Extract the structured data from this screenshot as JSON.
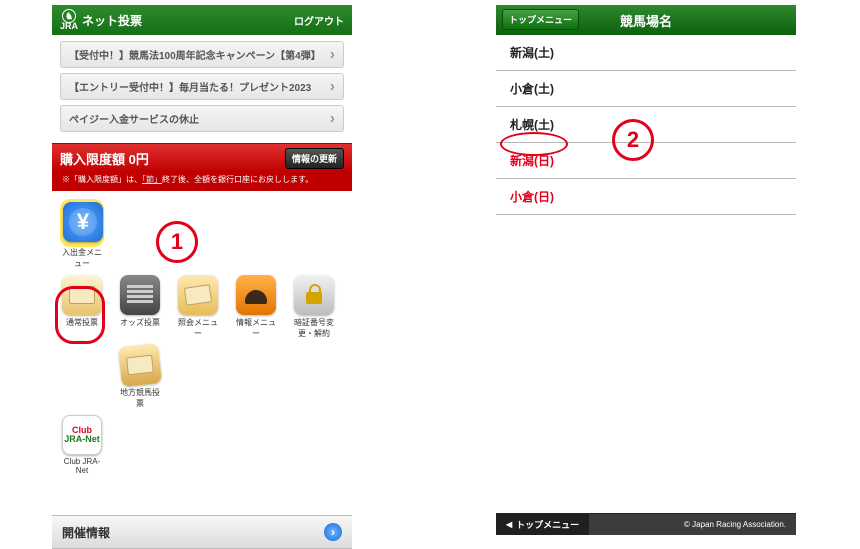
{
  "left": {
    "brand_small": "JRA",
    "title": "ネット投票",
    "logout": "ログアウト",
    "news": [
      "【受付中！】競馬法100周年記念キャンペーン【第4弾】",
      "【エントリー受付中！】毎月当たる！プレゼント2023",
      "ペイジー入金サービスの休止"
    ],
    "limit_label": "購入限度額 0円",
    "limit_button": "情報の更新",
    "limit_note_a": "※「購入限度額」は、",
    "limit_note_link": "「節」",
    "limit_note_b": "終了後、全額を銀行口座にお戻しします。",
    "icons": {
      "yen": "入出金メニュー",
      "normal": "通常投票",
      "odds": "オッズ投票",
      "refund": "照会メニュー",
      "info": "情報メニュー",
      "lock": "暗証番号変更・解約",
      "chikei": "地方競馬投票",
      "club_line1": "Club",
      "club_line2": "JRA-Net",
      "club_label": "Club JRA-Net"
    },
    "section_header": "開催情報"
  },
  "right": {
    "back": "トップメニュー",
    "title": "競馬場名",
    "courses": [
      {
        "label": "新潟(土)",
        "hot": false
      },
      {
        "label": "小倉(土)",
        "hot": false
      },
      {
        "label": "札幌(土)",
        "hot": false
      },
      {
        "label": "新潟(日)",
        "hot": true
      },
      {
        "label": "小倉(日)",
        "hot": true
      }
    ],
    "bottom_tm": "トップメニュー",
    "copyright": "© Japan Racing Association."
  },
  "annotations": {
    "one": "1",
    "two": "2"
  }
}
